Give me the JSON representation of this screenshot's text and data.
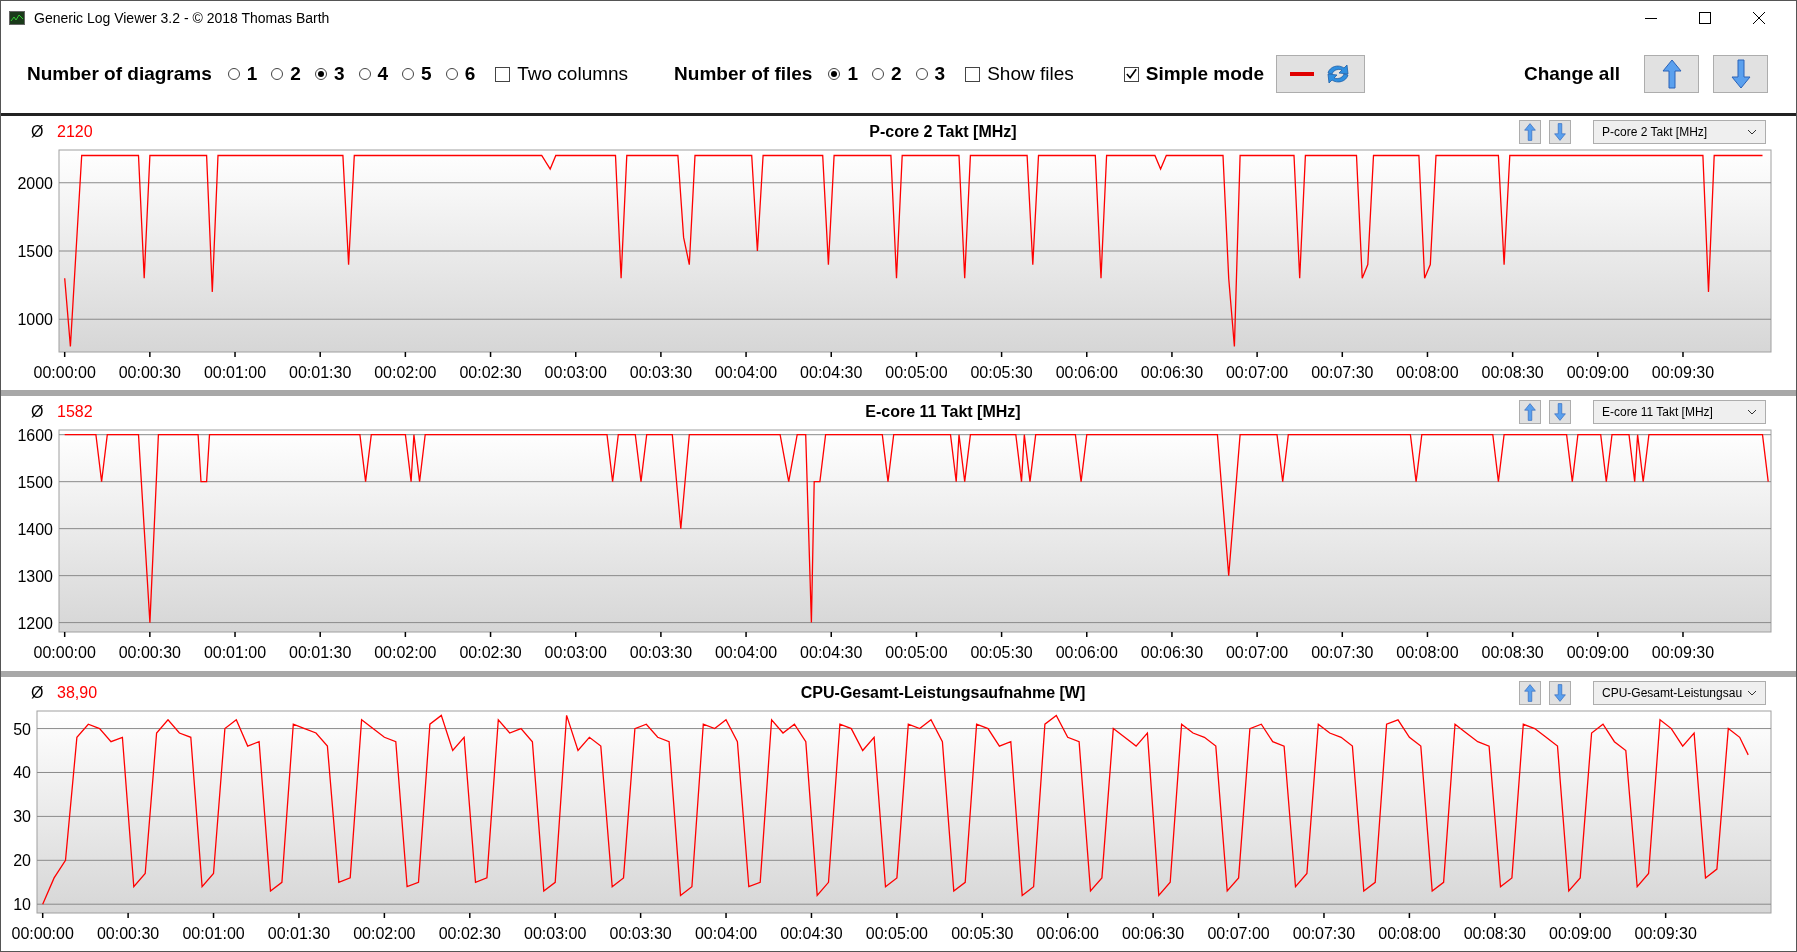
{
  "window": {
    "title": "Generic Log Viewer 3.2 - © 2018 Thomas Barth"
  },
  "toolbar": {
    "diagrams": {
      "label": "Number of diagrams",
      "options": [
        {
          "label": "1",
          "selected": false
        },
        {
          "label": "2",
          "selected": false
        },
        {
          "label": "3",
          "selected": true
        },
        {
          "label": "4",
          "selected": false
        },
        {
          "label": "5",
          "selected": false
        },
        {
          "label": "6",
          "selected": false
        }
      ]
    },
    "two_columns": {
      "label": "Two columns",
      "checked": false
    },
    "files": {
      "label": "Number of files",
      "options": [
        {
          "label": "1",
          "selected": true
        },
        {
          "label": "2",
          "selected": false
        },
        {
          "label": "3",
          "selected": false
        }
      ]
    },
    "show_files": {
      "label": "Show files",
      "checked": false
    },
    "simple_mode": {
      "label": "Simple mode",
      "checked": true
    },
    "change_all": {
      "label": "Change all"
    }
  },
  "diagrams": [
    {
      "average_symbol": "Ø",
      "average": "2120",
      "title": "P-core 2 Takt [MHz]",
      "selector": "P-core 2 Takt [MHz]",
      "chart_data": {
        "type": "line",
        "grid": true,
        "xlim": [
          -2,
          601
        ],
        "ylim": [
          760,
          2240
        ],
        "yticks": [
          1000,
          1500,
          2000
        ],
        "xticks": [
          {
            "value": 0,
            "label": "00:00:00"
          },
          {
            "value": 30,
            "label": "00:00:30"
          },
          {
            "value": 60,
            "label": "00:01:00"
          },
          {
            "value": 90,
            "label": "00:01:30"
          },
          {
            "value": 120,
            "label": "00:02:00"
          },
          {
            "value": 150,
            "label": "00:02:30"
          },
          {
            "value": 180,
            "label": "00:03:00"
          },
          {
            "value": 210,
            "label": "00:03:30"
          },
          {
            "value": 240,
            "label": "00:04:00"
          },
          {
            "value": 270,
            "label": "00:04:30"
          },
          {
            "value": 300,
            "label": "00:05:00"
          },
          {
            "value": 330,
            "label": "00:05:30"
          },
          {
            "value": 360,
            "label": "00:06:00"
          },
          {
            "value": 390,
            "label": "00:06:30"
          },
          {
            "value": 420,
            "label": "00:07:00"
          },
          {
            "value": 450,
            "label": "00:07:30"
          },
          {
            "value": 480,
            "label": "00:08:00"
          },
          {
            "value": 510,
            "label": "00:08:30"
          },
          {
            "value": 540,
            "label": "00:09:00"
          },
          {
            "value": 570,
            "label": "00:09:30"
          }
        ],
        "x": [
          0,
          2,
          6,
          26,
          28,
          30,
          50,
          52,
          54,
          98,
          100,
          102,
          168,
          171,
          173,
          194,
          196,
          198,
          216,
          218,
          220,
          222,
          242,
          244,
          246,
          267,
          269,
          271,
          291,
          293,
          295,
          315,
          317,
          319,
          339,
          341,
          343,
          363,
          365,
          367,
          384,
          386,
          388,
          408,
          410,
          412,
          414,
          433,
          435,
          437,
          455,
          457,
          459,
          461,
          477,
          479,
          481,
          483,
          505,
          507,
          509,
          577,
          579,
          581,
          598
        ],
        "series": [
          {
            "color": "#ff0000",
            "values": [
              1300,
              800,
              2200,
              2200,
              1300,
              2200,
              2200,
              1200,
              2200,
              2200,
              1400,
              2200,
              2200,
              2100,
              2200,
              2200,
              1300,
              2200,
              2200,
              1600,
              1400,
              2200,
              2200,
              1500,
              2200,
              2200,
              1400,
              2200,
              2200,
              1300,
              2200,
              2200,
              1300,
              2200,
              2200,
              1400,
              2200,
              2200,
              1300,
              2200,
              2200,
              2100,
              2200,
              2200,
              1300,
              800,
              2200,
              2200,
              1300,
              2200,
              2200,
              1300,
              1400,
              2200,
              2200,
              1300,
              1400,
              2200,
              2200,
              1400,
              2200,
              2200,
              1200,
              2200,
              2200
            ]
          }
        ]
      }
    },
    {
      "average_symbol": "Ø",
      "average": "1582",
      "title": "E-core 11 Takt [MHz]",
      "selector": "E-core 11 Takt [MHz]",
      "chart_data": {
        "type": "line",
        "grid": true,
        "xlim": [
          -2,
          601
        ],
        "ylim": [
          1180,
          1610
        ],
        "yticks": [
          1200,
          1300,
          1400,
          1500,
          1600
        ],
        "xticks": [
          {
            "value": 0,
            "label": "00:00:00"
          },
          {
            "value": 30,
            "label": "00:00:30"
          },
          {
            "value": 60,
            "label": "00:01:00"
          },
          {
            "value": 90,
            "label": "00:01:30"
          },
          {
            "value": 120,
            "label": "00:02:00"
          },
          {
            "value": 150,
            "label": "00:02:30"
          },
          {
            "value": 180,
            "label": "00:03:00"
          },
          {
            "value": 210,
            "label": "00:03:30"
          },
          {
            "value": 240,
            "label": "00:04:00"
          },
          {
            "value": 270,
            "label": "00:04:30"
          },
          {
            "value": 300,
            "label": "00:05:00"
          },
          {
            "value": 330,
            "label": "00:05:30"
          },
          {
            "value": 360,
            "label": "00:06:00"
          },
          {
            "value": 390,
            "label": "00:06:30"
          },
          {
            "value": 420,
            "label": "00:07:00"
          },
          {
            "value": 450,
            "label": "00:07:30"
          },
          {
            "value": 480,
            "label": "00:08:00"
          },
          {
            "value": 510,
            "label": "00:08:30"
          },
          {
            "value": 540,
            "label": "00:09:00"
          },
          {
            "value": 570,
            "label": "00:09:30"
          }
        ],
        "x": [
          0,
          11,
          13,
          15,
          26,
          30,
          33,
          47,
          48,
          50,
          51,
          104,
          106,
          108,
          120,
          122,
          123,
          125,
          127,
          191,
          193,
          195,
          201,
          203,
          205,
          214,
          217,
          220,
          252,
          255,
          258,
          261,
          263,
          264,
          266,
          268,
          288,
          290,
          292,
          312,
          314,
          315,
          317,
          319,
          335,
          337,
          338,
          340,
          342,
          356,
          358,
          360,
          406,
          410,
          414,
          427,
          429,
          431,
          474,
          476,
          478,
          503,
          505,
          507,
          529,
          531,
          533,
          541,
          543,
          545,
          551,
          553,
          554,
          556,
          558,
          560,
          598,
          600
        ],
        "series": [
          {
            "color": "#ff0000",
            "values": [
              1600,
              1600,
              1500,
              1600,
              1600,
              1200,
              1600,
              1600,
              1500,
              1500,
              1600,
              1600,
              1500,
              1600,
              1600,
              1500,
              1600,
              1500,
              1600,
              1600,
              1500,
              1600,
              1600,
              1500,
              1600,
              1600,
              1400,
              1600,
              1600,
              1500,
              1600,
              1600,
              1200,
              1500,
              1500,
              1600,
              1600,
              1500,
              1600,
              1600,
              1500,
              1600,
              1500,
              1600,
              1600,
              1500,
              1600,
              1500,
              1600,
              1600,
              1500,
              1600,
              1600,
              1300,
              1600,
              1600,
              1500,
              1600,
              1600,
              1500,
              1600,
              1600,
              1500,
              1600,
              1600,
              1500,
              1600,
              1600,
              1500,
              1600,
              1600,
              1500,
              1600,
              1500,
              1600,
              1600,
              1600,
              1500
            ]
          }
        ]
      }
    },
    {
      "average_symbol": "Ø",
      "average": "38,90",
      "title": "CPU-Gesamt-Leistungsaufnahme [W]",
      "selector": "CPU-Gesamt-Leistungsau",
      "chart_data": {
        "type": "line",
        "grid": true,
        "xlim": [
          -2,
          607
        ],
        "ylim": [
          8,
          54
        ],
        "yticks": [
          10,
          20,
          30,
          40,
          50
        ],
        "xticks": [
          {
            "value": 0,
            "label": "00:00:00"
          },
          {
            "value": 30,
            "label": "00:00:30"
          },
          {
            "value": 60,
            "label": "00:01:00"
          },
          {
            "value": 90,
            "label": "00:01:30"
          },
          {
            "value": 120,
            "label": "00:02:00"
          },
          {
            "value": 150,
            "label": "00:02:30"
          },
          {
            "value": 180,
            "label": "00:03:00"
          },
          {
            "value": 210,
            "label": "00:03:30"
          },
          {
            "value": 240,
            "label": "00:04:00"
          },
          {
            "value": 270,
            "label": "00:04:30"
          },
          {
            "value": 300,
            "label": "00:05:00"
          },
          {
            "value": 330,
            "label": "00:05:30"
          },
          {
            "value": 360,
            "label": "00:06:00"
          },
          {
            "value": 390,
            "label": "00:06:30"
          },
          {
            "value": 420,
            "label": "00:07:00"
          },
          {
            "value": 450,
            "label": "00:07:30"
          },
          {
            "value": 480,
            "label": "00:08:00"
          },
          {
            "value": 510,
            "label": "00:08:30"
          },
          {
            "value": 540,
            "label": "00:09:00"
          },
          {
            "value": 570,
            "label": "00:09:30"
          }
        ],
        "x": [
          0,
          4,
          8,
          12,
          16,
          20,
          24,
          28,
          32,
          36,
          40,
          44,
          48,
          52,
          56,
          60,
          64,
          68,
          72,
          76,
          80,
          84,
          88,
          92,
          96,
          100,
          104,
          108,
          112,
          116,
          120,
          124,
          128,
          132,
          136,
          140,
          144,
          148,
          152,
          156,
          160,
          164,
          168,
          172,
          176,
          180,
          184,
          188,
          192,
          196,
          200,
          204,
          208,
          212,
          216,
          220,
          224,
          228,
          232,
          236,
          240,
          244,
          248,
          252,
          256,
          260,
          264,
          268,
          272,
          276,
          280,
          284,
          288,
          292,
          296,
          300,
          304,
          308,
          312,
          316,
          320,
          324,
          328,
          332,
          336,
          340,
          344,
          348,
          352,
          356,
          360,
          364,
          368,
          372,
          376,
          380,
          384,
          388,
          392,
          396,
          400,
          404,
          408,
          412,
          416,
          420,
          424,
          428,
          432,
          436,
          440,
          444,
          448,
          452,
          456,
          460,
          464,
          468,
          472,
          476,
          480,
          484,
          488,
          492,
          496,
          500,
          504,
          508,
          512,
          516,
          520,
          524,
          528,
          532,
          536,
          540,
          544,
          548,
          552,
          556,
          560,
          564,
          568,
          572,
          576,
          580,
          584,
          588,
          592,
          596,
          599
        ],
        "series": [
          {
            "color": "#ff0000",
            "values": [
              10,
              16,
              20,
              48,
              51,
              50,
              47,
              48,
              14,
              17,
              49,
              52,
              49,
              48,
              14,
              17,
              50,
              52,
              46,
              47,
              13,
              15,
              51,
              50,
              49,
              46,
              15,
              16,
              52,
              50,
              48,
              47,
              14,
              15,
              51,
              53,
              45,
              48,
              15,
              16,
              52,
              49,
              50,
              47,
              13,
              15,
              53,
              45,
              48,
              46,
              14,
              16,
              50,
              51,
              48,
              47,
              12,
              14,
              51,
              50,
              52,
              47,
              14,
              15,
              52,
              49,
              51,
              47,
              12,
              15,
              51,
              50,
              45,
              48,
              14,
              16,
              51,
              50,
              52,
              47,
              13,
              15,
              51,
              50,
              46,
              47,
              12,
              14,
              51,
              53,
              48,
              47,
              13,
              16,
              50,
              48,
              46,
              49,
              12,
              15,
              51,
              49,
              48,
              46,
              13,
              16,
              50,
              51,
              47,
              46,
              14,
              17,
              51,
              49,
              48,
              46,
              13,
              15,
              51,
              52,
              48,
              46,
              13,
              15,
              51,
              49,
              47,
              46,
              14,
              16,
              51,
              50,
              48,
              46,
              13,
              16,
              49,
              51,
              47,
              45,
              14,
              17,
              52,
              50,
              46,
              49,
              16,
              18,
              50,
              48,
              44
            ]
          }
        ]
      }
    }
  ]
}
